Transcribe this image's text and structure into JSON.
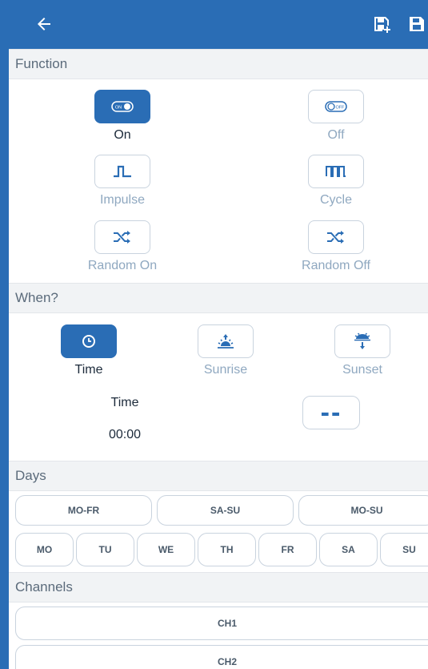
{
  "colors": {
    "primary": "#2a6db5",
    "muted_label": "#8fa8c0"
  },
  "appbar": {
    "back_icon": "arrow-left-icon",
    "save_as_icon": "save-as-icon",
    "save_icon": "save-icon"
  },
  "function": {
    "header": "Function",
    "options": [
      {
        "label": "On",
        "icon": "toggle-on-icon",
        "selected": true
      },
      {
        "label": "Off",
        "icon": "toggle-off-icon",
        "selected": false
      },
      {
        "label": "Impulse",
        "icon": "impulse-icon",
        "selected": false
      },
      {
        "label": "Cycle",
        "icon": "cycle-icon",
        "selected": false
      },
      {
        "label": "Random On",
        "icon": "shuffle-icon",
        "selected": false
      },
      {
        "label": "Random Off",
        "icon": "shuffle-icon",
        "selected": false
      }
    ]
  },
  "when": {
    "header": "When?",
    "options": [
      {
        "label": "Time",
        "icon": "clock-icon",
        "selected": true
      },
      {
        "label": "Sunrise",
        "icon": "sunrise-icon",
        "selected": false
      },
      {
        "label": "Sunset",
        "icon": "sunset-icon",
        "selected": false
      }
    ],
    "time_label": "Time",
    "time_value": "00:00",
    "offset_button_text": "--"
  },
  "days": {
    "header": "Days",
    "groups": [
      "MO-FR",
      "SA-SU",
      "MO-SU"
    ],
    "weekdays": [
      "MO",
      "TU",
      "WE",
      "TH",
      "FR",
      "SA",
      "SU"
    ]
  },
  "channels": {
    "header": "Channels",
    "items": [
      "CH1",
      "CH2"
    ]
  }
}
